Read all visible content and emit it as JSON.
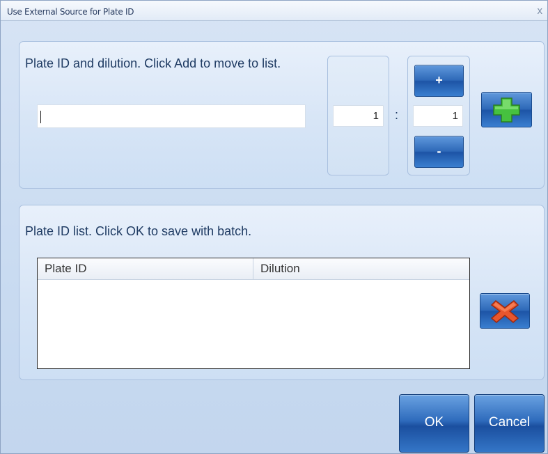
{
  "window": {
    "title": "Use External Source for Plate ID",
    "close_glyph": "x"
  },
  "entry_group": {
    "instruction": "Plate ID and dilution. Click Add to move to list.",
    "plate_id_value": "",
    "dilution_left_value": "1",
    "separator": ":",
    "dilution_right_value": "1",
    "increment_label": "+",
    "decrement_label": "-",
    "add_icon": "green-plus-icon"
  },
  "list_group": {
    "instruction": "Plate ID list. Click OK to save with batch.",
    "columns": [
      "Plate ID",
      "Dilution"
    ],
    "rows": [],
    "remove_icon": "red-x-icon"
  },
  "footer": {
    "ok_label": "OK",
    "cancel_label": "Cancel"
  },
  "colors": {
    "accent_blue": "#2e69b8",
    "panel_bg": "#d7e5f6",
    "text": "#1f3b63",
    "add_green": "#3fb63a",
    "remove_red": "#e2502a"
  }
}
